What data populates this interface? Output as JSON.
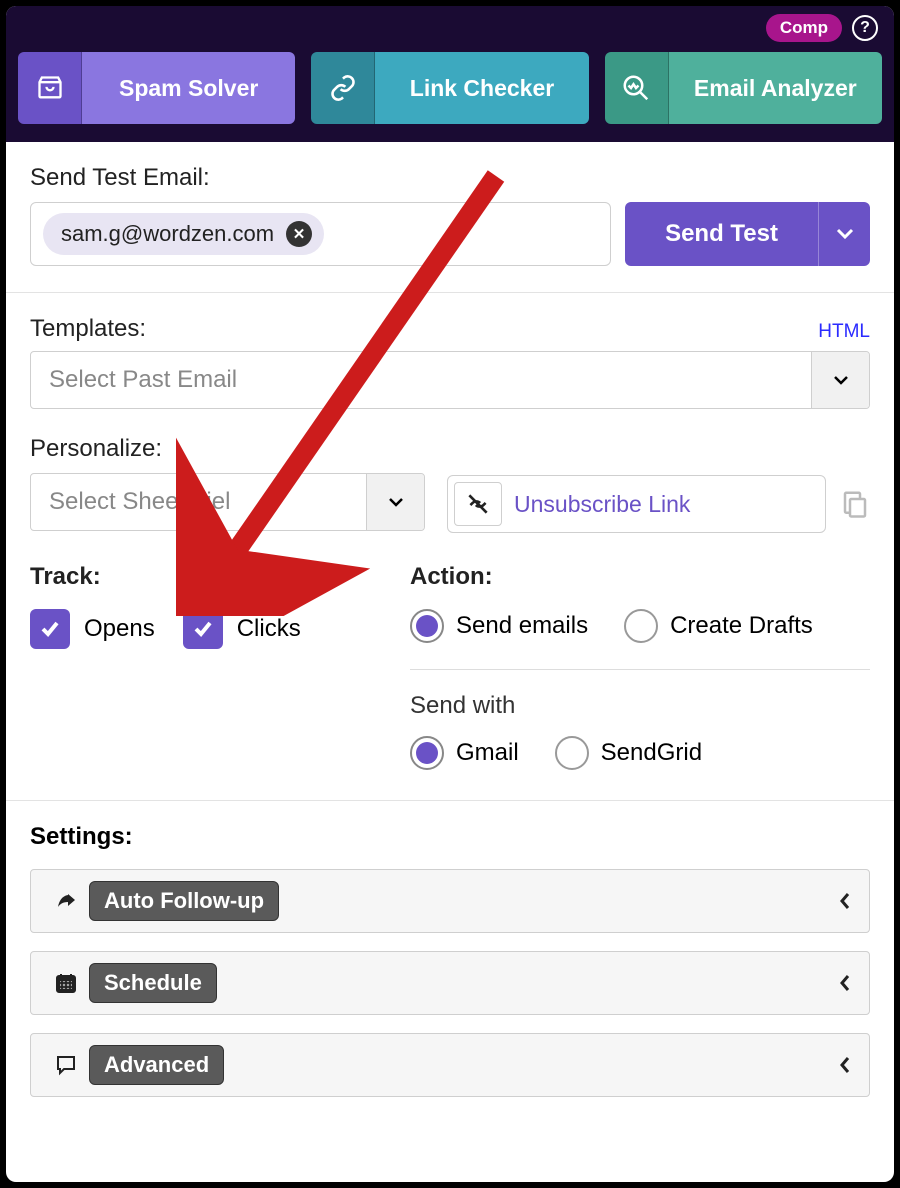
{
  "topbar": {
    "comp_badge": "Comp",
    "help": "?",
    "tools": {
      "spam": "Spam Solver",
      "link": "Link Checker",
      "analyzer": "Email Analyzer"
    }
  },
  "sendtest": {
    "label": "Send Test Email:",
    "chip_email": "sam.g@wordzen.com",
    "button": "Send Test"
  },
  "templates": {
    "label": "Templates:",
    "html_link": "HTML",
    "placeholder": "Select Past Email"
  },
  "personalize": {
    "label": "Personalize:",
    "placeholder": "Select Sheet Fiel",
    "unsubscribe": "Unsubscribe Link"
  },
  "track": {
    "label": "Track:",
    "opens": "Opens",
    "clicks": "Clicks"
  },
  "action": {
    "label": "Action:",
    "send_emails": "Send emails",
    "create_drafts": "Create Drafts",
    "send_with_label": "Send with",
    "gmail": "Gmail",
    "sendgrid": "SendGrid"
  },
  "settings": {
    "label": "Settings:",
    "auto_followup": "Auto Follow-up",
    "schedule": "Schedule",
    "advanced": "Advanced"
  }
}
